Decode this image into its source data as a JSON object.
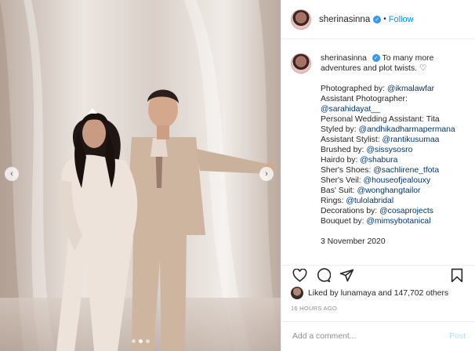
{
  "header": {
    "username": "sherinasinna",
    "separator": "•",
    "follow_label": "Follow",
    "verified_glyph": "✓"
  },
  "caption": {
    "username": "sherinasinna",
    "text": "To many more adventures and plot twists. ♡",
    "credits": [
      {
        "label": "Photographed by: ",
        "mention": "@ikmalawfar"
      },
      {
        "label": "Assistant Photographer: ",
        "mention": "@sarahidayat__"
      },
      {
        "label": "Personal Wedding Assistant: Tita",
        "mention": ""
      },
      {
        "label": "Styled by: ",
        "mention": "@andhikadharmapermana"
      },
      {
        "label": "Assistant Stylist: ",
        "mention": "@rantikusumaa"
      },
      {
        "label": "Brushed by: ",
        "mention": "@sissysosro"
      },
      {
        "label": "Hairdo by: ",
        "mention": "@shabura"
      },
      {
        "label": "Sher's Shoes: ",
        "mention": "@sachlirene_tfota"
      },
      {
        "label": "Sher's Veil: ",
        "mention": "@houseofjealouxy"
      },
      {
        "label": "Bas' Suit: ",
        "mention": "@wonghangtailor"
      },
      {
        "label": "Rings: ",
        "mention": "@tulolabridal"
      },
      {
        "label": "Decorations by: ",
        "mention": "@cosaprojects"
      },
      {
        "label": "Bouquet by: ",
        "mention": "@mimsybotanical"
      }
    ],
    "date": "3 November 2020"
  },
  "actions": {
    "icons": [
      "heart-icon",
      "comment-icon",
      "share-icon",
      "bookmark-icon"
    ]
  },
  "likes": {
    "prefix": "Liked by ",
    "user": "lunamaya",
    "middle": " and ",
    "count": "147,702 others"
  },
  "time_ago": "16 HOURS AGO",
  "comment_box": {
    "placeholder": "Add a comment...",
    "post_label": "Post"
  },
  "carousel": {
    "prev_glyph": "‹",
    "next_glyph": "›",
    "slide_count": 3,
    "active_slide": 2
  },
  "colors": {
    "accent": "#0095f6",
    "mention": "#00376b",
    "muted": "#8e8e8e",
    "post_disabled": "#b2dffc"
  }
}
